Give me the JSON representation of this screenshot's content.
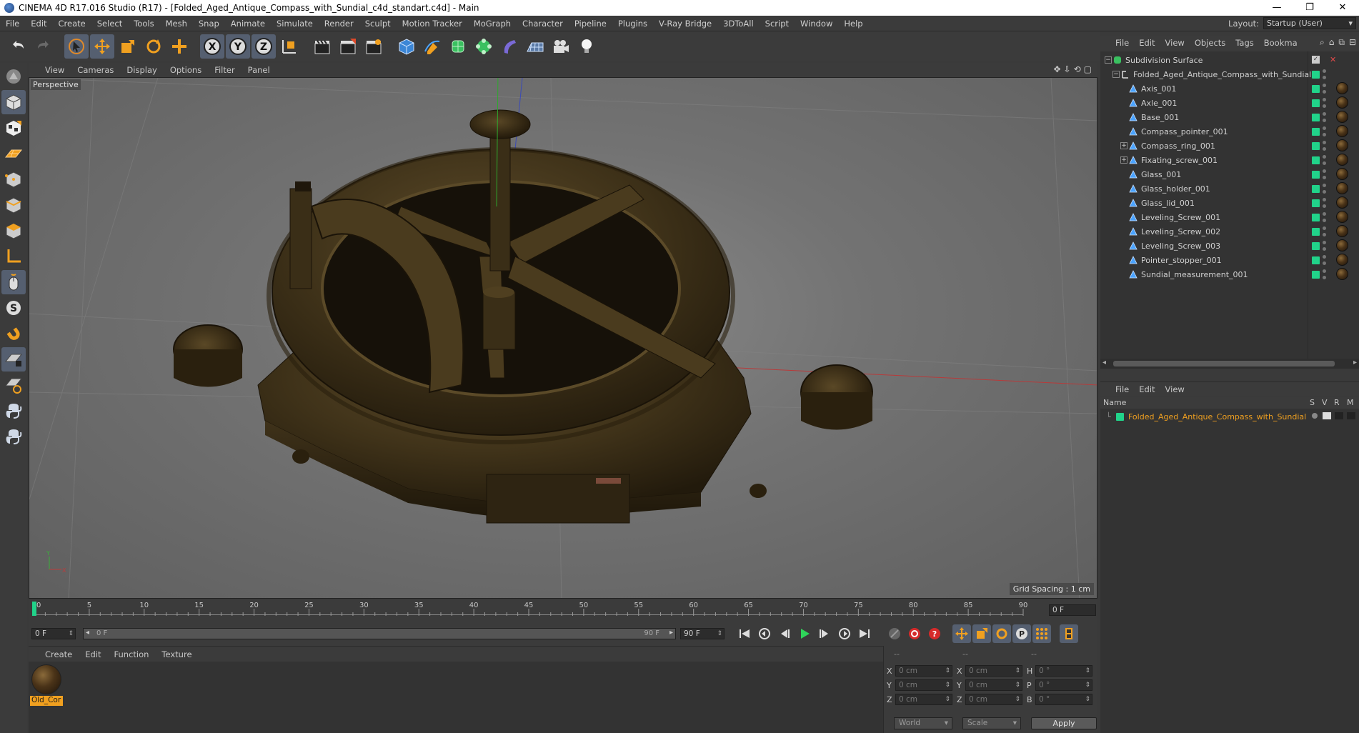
{
  "window": {
    "title": "CINEMA 4D R17.016 Studio (R17) - [Folded_Aged_Antique_Compass_with_Sundial_c4d_standart.c4d] - Main",
    "controls": [
      "—",
      "❐",
      "✕"
    ]
  },
  "menubar": {
    "items": [
      "File",
      "Edit",
      "Create",
      "Select",
      "Tools",
      "Mesh",
      "Snap",
      "Animate",
      "Simulate",
      "Render",
      "Sculpt",
      "Motion Tracker",
      "MoGraph",
      "Character",
      "Pipeline",
      "Plugins",
      "V-Ray Bridge",
      "3DToAll",
      "Script",
      "Window",
      "Help"
    ],
    "layout_label": "Layout:",
    "layout_value": "Startup (User)"
  },
  "toolbar": {
    "axis_labels": [
      "X",
      "Y",
      "Z"
    ]
  },
  "viewport": {
    "menu": [
      "View",
      "Cameras",
      "Display",
      "Options",
      "Filter",
      "Panel"
    ],
    "nav_icons": [
      "✥",
      "⇩",
      "⟲",
      "▢"
    ],
    "camera_label": "Perspective",
    "grid_spacing": "Grid Spacing : 1 cm",
    "axis_gizmo": {
      "y": "Y",
      "x": "X"
    }
  },
  "timeline": {
    "ticks": [
      0,
      5,
      10,
      15,
      20,
      25,
      30,
      35,
      40,
      45,
      50,
      55,
      60,
      65,
      70,
      75,
      80,
      85,
      90
    ],
    "max_frame": 90,
    "current_frame_box": "0 F"
  },
  "transport": {
    "start_field": "0 F",
    "range_start": "0 F",
    "range_end": "90 F",
    "end_field": "90 F"
  },
  "material_manager": {
    "menu": [
      "Create",
      "Edit",
      "Function",
      "Texture"
    ],
    "material_name": "Old_Cor"
  },
  "coordinates": {
    "header": [
      "--",
      "--",
      "--"
    ],
    "rows": [
      {
        "a_label": "X",
        "a_value": "0 cm",
        "b_label": "X",
        "b_value": "0 cm",
        "c_label": "H",
        "c_value": "0 °"
      },
      {
        "a_label": "Y",
        "a_value": "0 cm",
        "b_label": "Y",
        "b_value": "0 cm",
        "c_label": "P",
        "c_value": "0 °"
      },
      {
        "a_label": "Z",
        "a_value": "0 cm",
        "b_label": "Z",
        "b_value": "0 cm",
        "c_label": "B",
        "c_value": "0 °"
      }
    ],
    "space_dropdown": "World",
    "mode_dropdown": "Scale",
    "apply_label": "Apply"
  },
  "object_manager": {
    "menu": [
      "File",
      "Edit",
      "View",
      "Objects",
      "Tags",
      "Bookma"
    ],
    "objects": [
      {
        "name": "Subdivision Surface",
        "indent": 0,
        "expander": "−",
        "icon": "subdivision-icon",
        "flag": "check"
      },
      {
        "name": "Folded_Aged_Antique_Compass_with_Sundial",
        "indent": 1,
        "expander": "−",
        "icon": "null-icon",
        "flag": "green"
      },
      {
        "name": "Axis_001",
        "indent": 2,
        "expander": "",
        "icon": "polygon-icon",
        "flag": "green",
        "mat": true
      },
      {
        "name": "Axle_001",
        "indent": 2,
        "expander": "",
        "icon": "polygon-icon",
        "flag": "green",
        "mat": true
      },
      {
        "name": "Base_001",
        "indent": 2,
        "expander": "",
        "icon": "polygon-icon",
        "flag": "green",
        "mat": true
      },
      {
        "name": "Compass_pointer_001",
        "indent": 2,
        "expander": "",
        "icon": "polygon-icon",
        "flag": "green",
        "mat": true
      },
      {
        "name": "Compass_ring_001",
        "indent": 2,
        "expander": "+",
        "icon": "polygon-icon",
        "flag": "green",
        "mat": true
      },
      {
        "name": "Fixating_screw_001",
        "indent": 2,
        "expander": "+",
        "icon": "polygon-icon",
        "flag": "green",
        "mat": true
      },
      {
        "name": "Glass_001",
        "indent": 2,
        "expander": "",
        "icon": "polygon-icon",
        "flag": "green",
        "mat": true
      },
      {
        "name": "Glass_holder_001",
        "indent": 2,
        "expander": "",
        "icon": "polygon-icon",
        "flag": "green",
        "mat": true
      },
      {
        "name": "Glass_lid_001",
        "indent": 2,
        "expander": "",
        "icon": "polygon-icon",
        "flag": "green",
        "mat": true
      },
      {
        "name": "Leveling_Screw_001",
        "indent": 2,
        "expander": "",
        "icon": "polygon-icon",
        "flag": "green",
        "mat": true
      },
      {
        "name": "Leveling_Screw_002",
        "indent": 2,
        "expander": "",
        "icon": "polygon-icon",
        "flag": "green",
        "mat": true
      },
      {
        "name": "Leveling_Screw_003",
        "indent": 2,
        "expander": "",
        "icon": "polygon-icon",
        "flag": "green",
        "mat": true
      },
      {
        "name": "Pointer_stopper_001",
        "indent": 2,
        "expander": "",
        "icon": "polygon-icon",
        "flag": "green",
        "mat": true
      },
      {
        "name": "Sundial_measurement_001",
        "indent": 2,
        "expander": "",
        "icon": "polygon-icon",
        "flag": "green",
        "mat": true
      }
    ]
  },
  "layer_manager": {
    "menu": [
      "File",
      "Edit",
      "View"
    ],
    "columns": [
      "Name",
      "S",
      "V",
      "R",
      "M"
    ],
    "row_name": "Folded_Aged_Antique_Compass_with_Sundial"
  },
  "colors": {
    "accent_orange": "#f0a020",
    "flag_green": "#21d38a",
    "panel_bg": "#333333",
    "active_tool": "#555f70"
  }
}
